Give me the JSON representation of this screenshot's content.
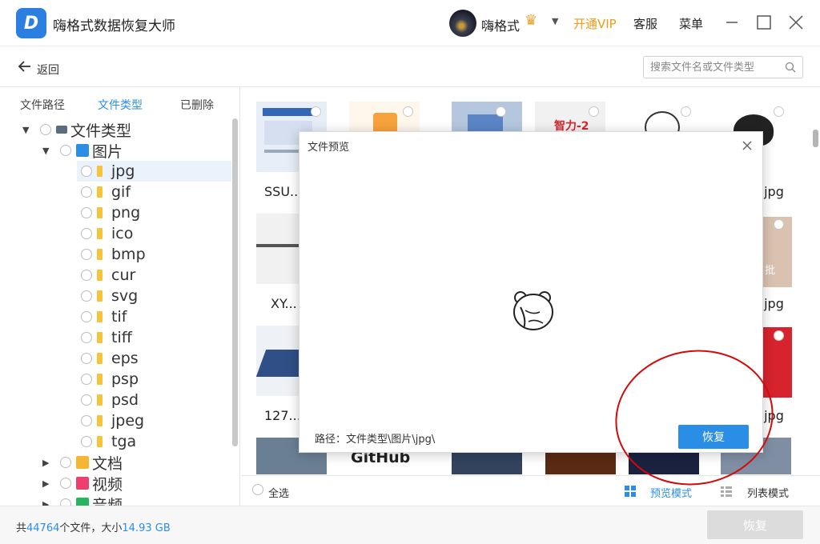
{
  "app": {
    "title": "嗨格式数据恢复大师",
    "logo_letter": "D"
  },
  "user": {
    "name": "嗨格式",
    "vip_link": "开通VIP",
    "service_link": "客服",
    "menu_link": "菜单"
  },
  "window_controls": [
    "minimize",
    "maximize",
    "close"
  ],
  "toolbar": {
    "back_label": "返回",
    "search_placeholder": "搜索文件名或文件类型"
  },
  "tabs": [
    {
      "label": "文件路径",
      "active": false
    },
    {
      "label": "文件类型",
      "active": true
    },
    {
      "label": "已删除",
      "active": false
    }
  ],
  "tree": {
    "root": "文件类型",
    "images_label": "图片",
    "image_types": [
      "jpg",
      "gif",
      "png",
      "ico",
      "bmp",
      "cur",
      "svg",
      "tif",
      "tiff",
      "eps",
      "psp",
      "psd",
      "jpeg",
      "tga"
    ],
    "documents_label": "文档",
    "videos_label": "视频",
    "audio_label": "音频"
  },
  "grid": {
    "row1_names": [
      "SSU...",
      "",
      "",
      "",
      "",
      ".jpg"
    ],
    "row1_tile_text": "智力-2",
    "row2_names": [
      "XY...",
      ".jpg"
    ],
    "row2_tile_text": "批",
    "row3_names": [
      "127...",
      ".jpg"
    ],
    "row4_tile_text": "GitHub"
  },
  "bottom_bar": {
    "select_all": "全选",
    "preview_mode": "预览模式",
    "list_mode": "列表模式"
  },
  "footer": {
    "prefix": "共",
    "file_count": "44764",
    "middle": "个文件，大小",
    "size": "14.93 GB",
    "recover_label": "恢复"
  },
  "dialog": {
    "title": "文件预览",
    "path_label": "路径：",
    "path_value": "文件类型\\图片\\jpg\\",
    "recover_label": "恢复"
  },
  "colors": {
    "accent": "#2a8de6",
    "vip": "#f19a14",
    "annotation": "#d40a0a"
  }
}
